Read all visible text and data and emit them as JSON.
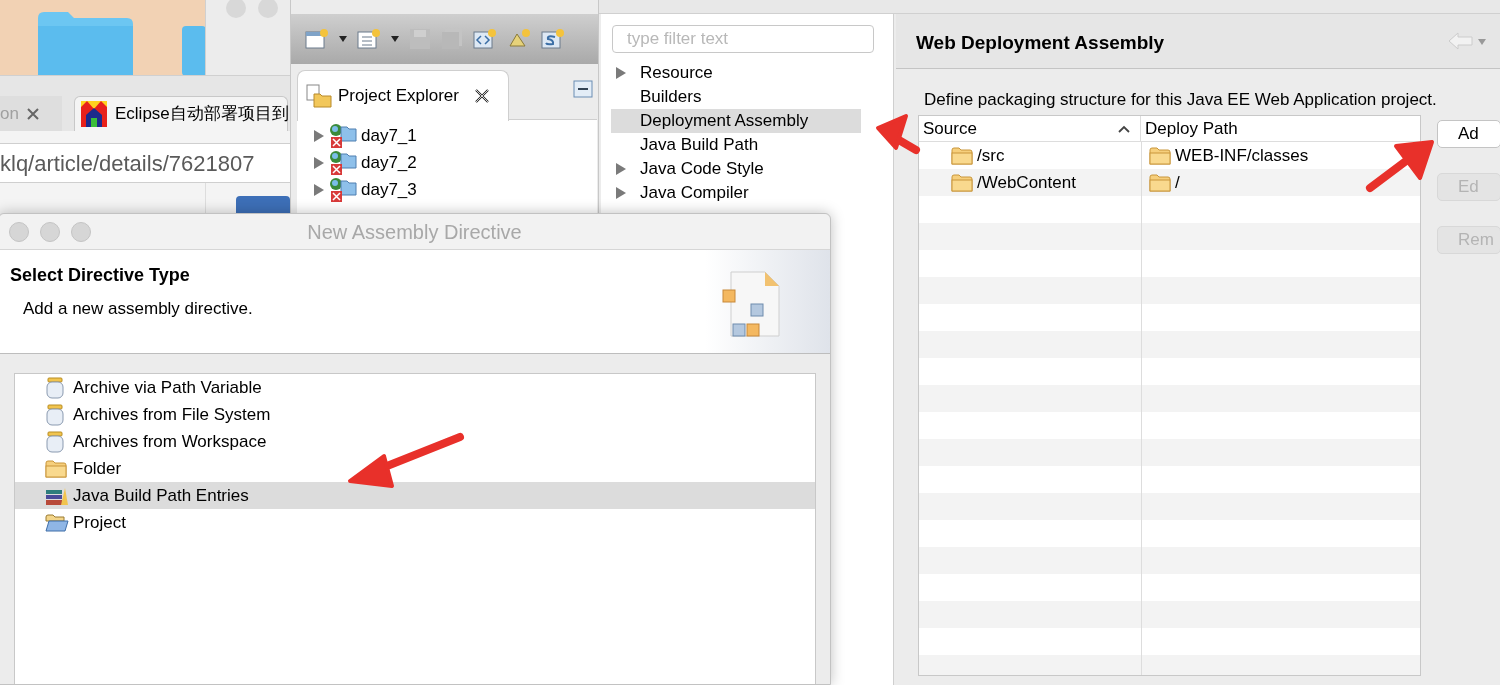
{
  "browser": {
    "tabs": [
      {
        "label": "on",
        "selected": false
      },
      {
        "label": "Eclipse自动部署项目到",
        "selected": true
      }
    ],
    "address": "klq/article/details/7621807"
  },
  "eclipse": {
    "view_tab": "Project Explorer",
    "tree": [
      {
        "label": "day7_1",
        "expanded": false
      },
      {
        "label": "day7_2",
        "expanded": false
      },
      {
        "label": "day7_3",
        "expanded": false
      }
    ]
  },
  "properties": {
    "filter_placeholder": "type filter text",
    "nav": [
      {
        "label": "Resource",
        "has_children": true,
        "selected": false
      },
      {
        "label": "Builders",
        "has_children": false,
        "selected": false
      },
      {
        "label": "Deployment Assembly",
        "has_children": false,
        "selected": true
      },
      {
        "label": "Java Build Path",
        "has_children": false,
        "selected": false
      },
      {
        "label": "Java Code Style",
        "has_children": true,
        "selected": false
      },
      {
        "label": "Java Compiler",
        "has_children": true,
        "selected": false
      }
    ],
    "page_title": "Web Deployment Assembly",
    "description": "Define packaging structure for this Java EE Web Application project.",
    "table": {
      "columns": [
        "Source",
        "Deploy Path"
      ],
      "rows": [
        {
          "source": "/src",
          "deploy_path": "WEB-INF/classes"
        },
        {
          "source": "/WebContent",
          "deploy_path": "/"
        }
      ]
    },
    "buttons": [
      {
        "label": "Ad",
        "disabled": false
      },
      {
        "label": "Ed",
        "disabled": true
      },
      {
        "label": "Rem",
        "disabled": true
      }
    ]
  },
  "dialog": {
    "title": "New Assembly Directive",
    "heading": "Select Directive Type",
    "subtitle": "Add a new assembly directive.",
    "types": [
      {
        "label": "Archive via Path Variable",
        "kind": "jar",
        "selected": false
      },
      {
        "label": "Archives from File System",
        "kind": "jar",
        "selected": false
      },
      {
        "label": "Archives from Workspace",
        "kind": "jar",
        "selected": false
      },
      {
        "label": "Folder",
        "kind": "folder",
        "selected": false
      },
      {
        "label": "Java Build Path Entries",
        "kind": "library",
        "selected": true
      },
      {
        "label": "Project",
        "kind": "project",
        "selected": false
      }
    ]
  }
}
